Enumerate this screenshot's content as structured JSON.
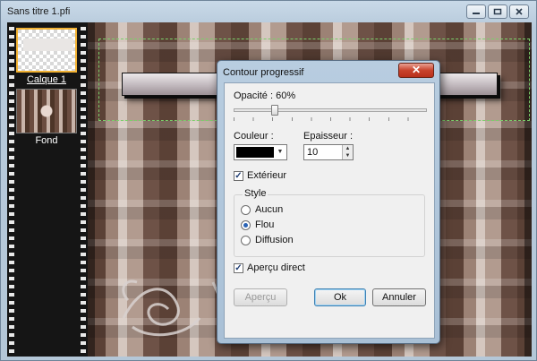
{
  "window": {
    "title": "Sans titre 1.pfi",
    "minimize_icon": "minimize-icon",
    "maximize_icon": "maximize-icon",
    "close_icon": "close-icon"
  },
  "layers": [
    {
      "label": "Calque 1",
      "selected": true
    },
    {
      "label": "Fond",
      "selected": false
    }
  ],
  "dialog": {
    "title": "Contour progressif",
    "close_glyph": "✕",
    "opacity_label": "Opacité : 60%",
    "opacity_value": 60,
    "color_label": "Couleur :",
    "color_value": "#000000",
    "thickness_label": "Epaisseur :",
    "thickness_value": "10",
    "exterior_label": "Extérieur",
    "exterior_checked": true,
    "style_group_label": "Style",
    "style_options": [
      {
        "label": "Aucun",
        "selected": false
      },
      {
        "label": "Flou",
        "selected": true
      },
      {
        "label": "Diffusion",
        "selected": false
      }
    ],
    "preview_label": "Aperçu direct",
    "preview_checked": true,
    "buttons": {
      "apercu": "Aperçu",
      "ok": "Ok",
      "annuler": "Annuler"
    }
  },
  "colors": {
    "selection_border": "#f2b233",
    "dialog_close": "#c8432c",
    "marquee": "#7ad06a"
  }
}
